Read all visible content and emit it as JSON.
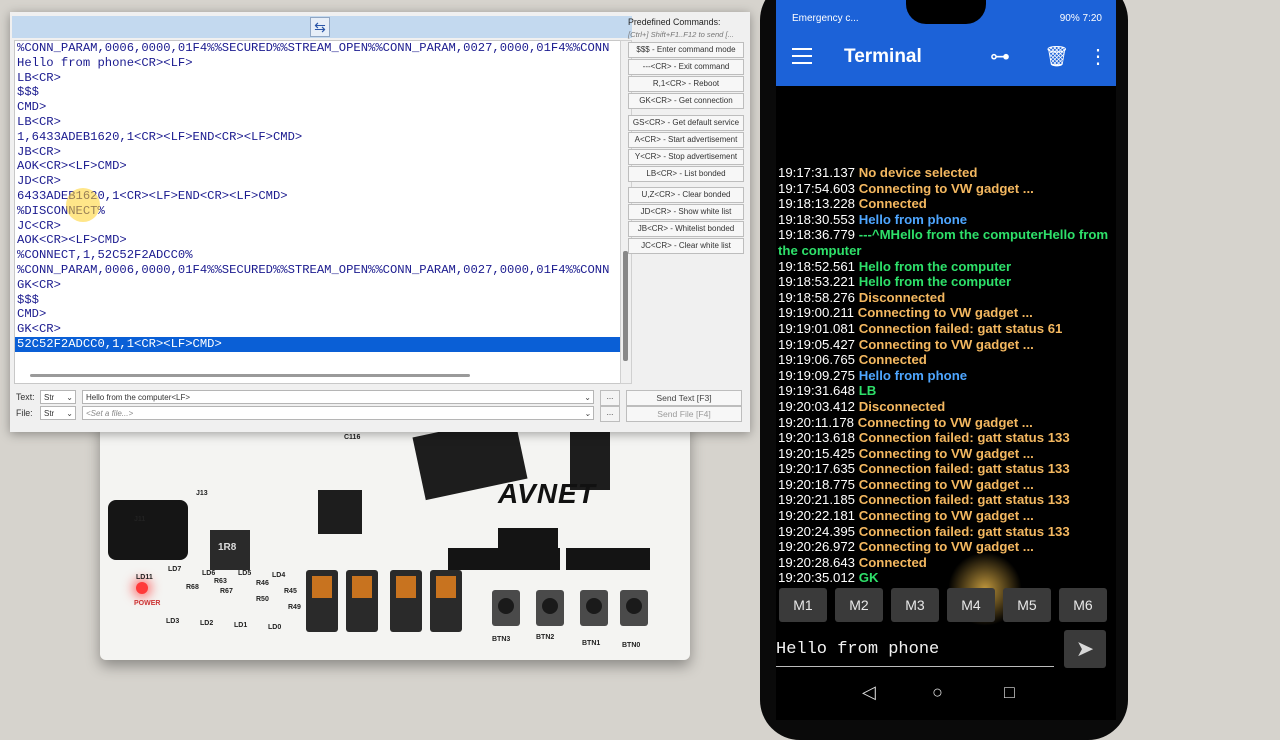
{
  "window": {
    "log_lines": [
      "%CONN_PARAM,0006,0000,01F4%%SECURED%%STREAM_OPEN%%CONN_PARAM,0027,0000,01F4%%CONN",
      "Hello from phone<CR><LF>",
      "LB<CR>",
      "$$$",
      "CMD>",
      "LB<CR>",
      "1,6433ADEB1620,1<CR><LF>END<CR><LF>CMD>",
      "JB<CR>",
      "AOK<CR><LF>CMD>",
      "JD<CR>",
      "6433ADEB1620,1<CR><LF>END<CR><LF>CMD>",
      "%DISCONNECT%",
      "JC<CR>",
      "AOK<CR><LF>CMD>",
      "%CONNECT,1,52C52F2ADCC0%",
      "%CONN_PARAM,0006,0000,01F4%%SECURED%%STREAM_OPEN%%CONN_PARAM,0027,0000,01F4%%CONN",
      "GK<CR>",
      "$$$",
      "CMD>",
      "GK<CR>",
      "52C52F2ADCC0,1,1<CR><LF>CMD>"
    ],
    "selected_line": "52C52F2ADCC0,1,1<CR><LF>CMD>",
    "predefined": {
      "title": "Predefined Commands:",
      "hint": "[Ctrl+] Shift+F1..F12 to send [...",
      "group1": [
        "$$$ - Enter command mode",
        "---<CR> - Exit command",
        "R,1<CR> - Reboot",
        "GK<CR> - Get connection"
      ],
      "group2": [
        "GS<CR> - Get default service",
        "A<CR> - Start advertisement",
        "Y<CR> - Stop advertisement",
        "LB<CR> - List bonded"
      ],
      "group3": [
        "U,Z<CR> - Clear bonded",
        "JD<CR> - Show white list",
        "JB<CR> - Whitelist bonded",
        "JC<CR> - Clear white list"
      ]
    },
    "text_row": {
      "label": "Text:",
      "mode": "Str",
      "value": "Hello from the computer<LF>",
      "dots": "...",
      "send": "Send Text [F3]"
    },
    "file_row": {
      "label": "File:",
      "mode": "Str",
      "placeholder": "<Set a file...>",
      "dots": "...",
      "send": "Send File [F4]"
    }
  },
  "phone": {
    "status_left": "Emergency c...",
    "status_right": "90% 7:20",
    "app_title": "Terminal",
    "log": [
      {
        "t": "19:17:31.137",
        "m": "No device selected",
        "k": "status"
      },
      {
        "t": "19:17:54.603",
        "m": "Connecting to VW gadget ...",
        "k": "status"
      },
      {
        "t": "19:18:13.228",
        "m": "Connected",
        "k": "status"
      },
      {
        "t": "19:18:30.553",
        "m": "Hello from phone",
        "k": "sent"
      },
      {
        "t": "19:18:36.779",
        "m": "---^MHello from the computerHello from the computer",
        "k": "recv"
      },
      {
        "t": "19:18:52.561",
        "m": "Hello from the computer",
        "k": "recv"
      },
      {
        "t": "19:18:53.221",
        "m": "Hello from the computer",
        "k": "recv"
      },
      {
        "t": "19:18:58.276",
        "m": "Disconnected",
        "k": "status"
      },
      {
        "t": "19:19:00.211",
        "m": "Connecting to VW gadget ...",
        "k": "status"
      },
      {
        "t": "19:19:01.081",
        "m": "Connection failed: gatt status 61",
        "k": "status"
      },
      {
        "t": "19:19:05.427",
        "m": "Connecting to VW gadget ...",
        "k": "status"
      },
      {
        "t": "19:19:06.765",
        "m": "Connected",
        "k": "status"
      },
      {
        "t": "19:19:09.275",
        "m": "Hello from phone",
        "k": "sent"
      },
      {
        "t": "19:19:31.648",
        "m": "LB",
        "k": "recv"
      },
      {
        "t": "19:20:03.412",
        "m": "Disconnected",
        "k": "status"
      },
      {
        "t": "19:20:11.178",
        "m": "Connecting to VW gadget ...",
        "k": "status"
      },
      {
        "t": "19:20:13.618",
        "m": "Connection failed: gatt status 133",
        "k": "status"
      },
      {
        "t": "19:20:15.425",
        "m": "Connecting to VW gadget ...",
        "k": "status"
      },
      {
        "t": "19:20:17.635",
        "m": "Connection failed: gatt status 133",
        "k": "status"
      },
      {
        "t": "19:20:18.775",
        "m": "Connecting to VW gadget ...",
        "k": "status"
      },
      {
        "t": "19:20:21.185",
        "m": "Connection failed: gatt status 133",
        "k": "status"
      },
      {
        "t": "19:20:22.181",
        "m": "Connecting to VW gadget ...",
        "k": "status"
      },
      {
        "t": "19:20:24.395",
        "m": "Connection failed: gatt status 133",
        "k": "status"
      },
      {
        "t": "19:20:26.972",
        "m": "Connecting to VW gadget ...",
        "k": "status"
      },
      {
        "t": "19:20:28.643",
        "m": "Connected",
        "k": "status"
      },
      {
        "t": "19:20:35.012",
        "m": "GK",
        "k": "recv"
      }
    ],
    "macros": [
      "M1",
      "M2",
      "M3",
      "M4",
      "M5",
      "M6"
    ],
    "input_value": "Hello from phone",
    "colors": {
      "appbar": "#1c62d8",
      "status_text": "#f4b860",
      "sent_text": "#4ea6ff",
      "received_text": "#2ee06a"
    },
    "icons": [
      "menu-icon",
      "connect-plug-icon",
      "trash-icon",
      "more-vert-icon",
      "send-icon",
      "back-icon",
      "home-icon",
      "recents-icon"
    ]
  },
  "board": {
    "brand": "AVNET",
    "silk": [
      "J11",
      "C116",
      "J13",
      "1R8",
      "LD11",
      "POWER",
      "LD7",
      "LD6",
      "LD5",
      "LD4",
      "LD3",
      "LD2",
      "LD1",
      "LD0",
      "BTN3",
      "BTN2",
      "BTN1",
      "BTN0",
      "R63",
      "R46",
      "R45",
      "R50",
      "R67",
      "R68",
      "R49"
    ]
  }
}
